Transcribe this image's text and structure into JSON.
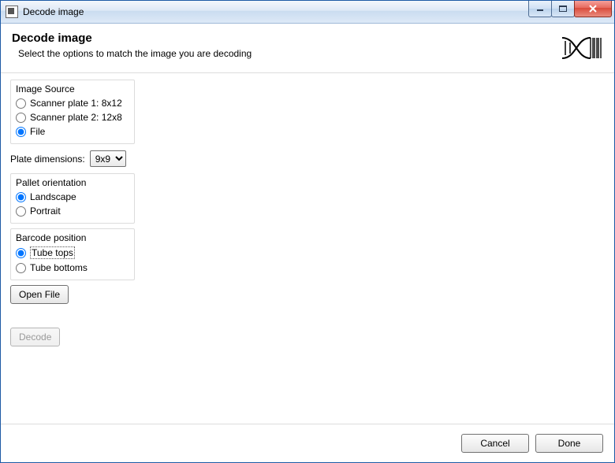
{
  "window": {
    "title": "Decode image"
  },
  "header": {
    "title": "Decode image",
    "subtitle": "Select the options to match the image you are decoding"
  },
  "imageSource": {
    "legend": "Image Source",
    "options": {
      "scanner1": "Scanner plate 1: 8x12",
      "scanner2": "Scanner plate 2: 12x8",
      "file": "File"
    },
    "selected": "file"
  },
  "plateDimensions": {
    "label": "Plate dimensions:",
    "selected": "9x9",
    "options": [
      "9x9"
    ]
  },
  "palletOrientation": {
    "legend": "Pallet orientation",
    "options": {
      "landscape": "Landscape",
      "portrait": "Portrait"
    },
    "selected": "landscape"
  },
  "barcodePosition": {
    "legend": "Barcode position",
    "options": {
      "tops": "Tube tops",
      "bottoms": "Tube bottoms"
    },
    "selected": "tops"
  },
  "buttons": {
    "openFile": "Open File",
    "decode": "Decode",
    "cancel": "Cancel",
    "done": "Done"
  },
  "state": {
    "decodeEnabled": false
  }
}
